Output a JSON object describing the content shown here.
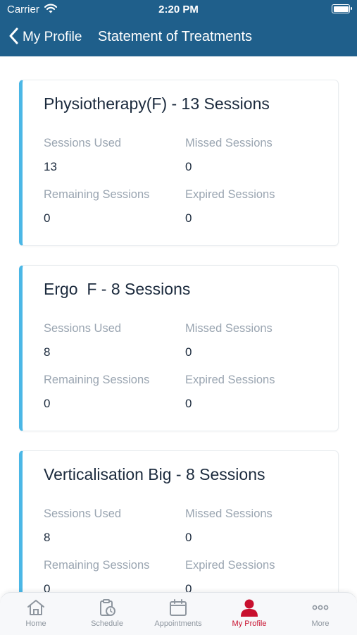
{
  "status_bar": {
    "carrier": "Carrier",
    "time": "2:20 PM"
  },
  "nav": {
    "back_label": "My Profile",
    "title": "Statement of Treatments"
  },
  "labels": {
    "sessions_used": "Sessions Used",
    "missed_sessions": "Missed Sessions",
    "remaining_sessions": "Remaining Sessions",
    "expired_sessions": "Expired Sessions"
  },
  "treatments": [
    {
      "title": "Physiotherapy(F) - 13 Sessions",
      "sessions_used": "13",
      "missed_sessions": "0",
      "remaining_sessions": "0",
      "expired_sessions": "0"
    },
    {
      "title": "Ergo  F - 8 Sessions",
      "sessions_used": "8",
      "missed_sessions": "0",
      "remaining_sessions": "0",
      "expired_sessions": "0"
    },
    {
      "title": "Verticalisation Big - 8 Sessions",
      "sessions_used": "8",
      "missed_sessions": "0",
      "remaining_sessions": "0",
      "expired_sessions": "0"
    }
  ],
  "tabs": [
    {
      "label": "Home",
      "icon": "home-icon"
    },
    {
      "label": "Schedule",
      "icon": "clipboard-clock-icon"
    },
    {
      "label": "Appointments",
      "icon": "calendar-icon"
    },
    {
      "label": "My Profile",
      "icon": "user-icon",
      "active": true
    },
    {
      "label": "More",
      "icon": "more-dots-icon"
    }
  ],
  "colors": {
    "header": "#1f5f8b",
    "card_accent": "#4bb7e6",
    "active_tab": "#c8102e",
    "inactive_tab": "#8e969f"
  }
}
